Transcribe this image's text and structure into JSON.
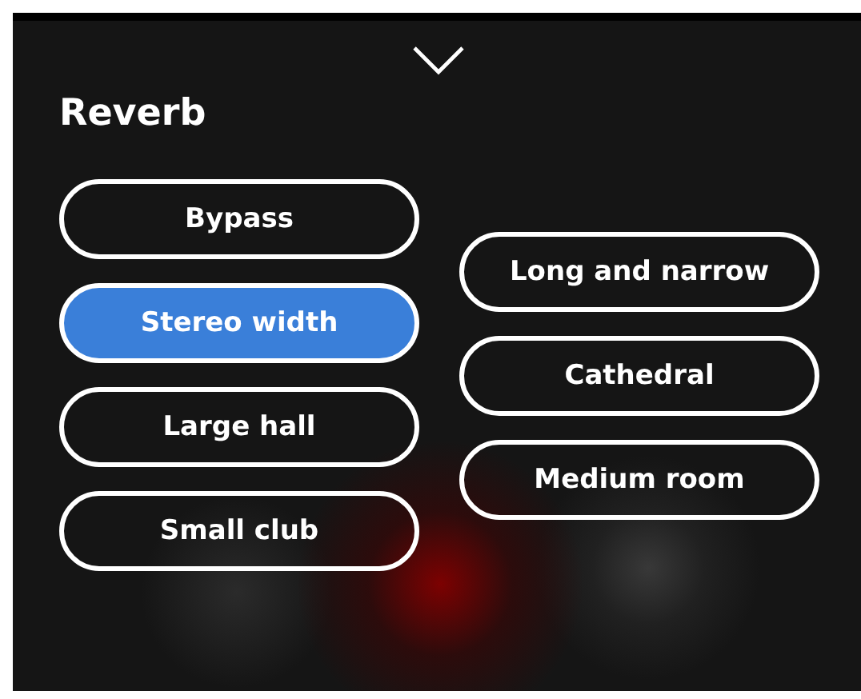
{
  "title": "Reverb",
  "columns": [
    [
      {
        "label": "Bypass",
        "selected": false
      },
      {
        "label": "Stereo width",
        "selected": true
      },
      {
        "label": "Large hall",
        "selected": false
      },
      {
        "label": "Small club",
        "selected": false
      }
    ],
    [
      {
        "label": "Long and narrow",
        "selected": false
      },
      {
        "label": "Cathedral",
        "selected": false
      },
      {
        "label": "Medium room",
        "selected": false
      }
    ]
  ]
}
